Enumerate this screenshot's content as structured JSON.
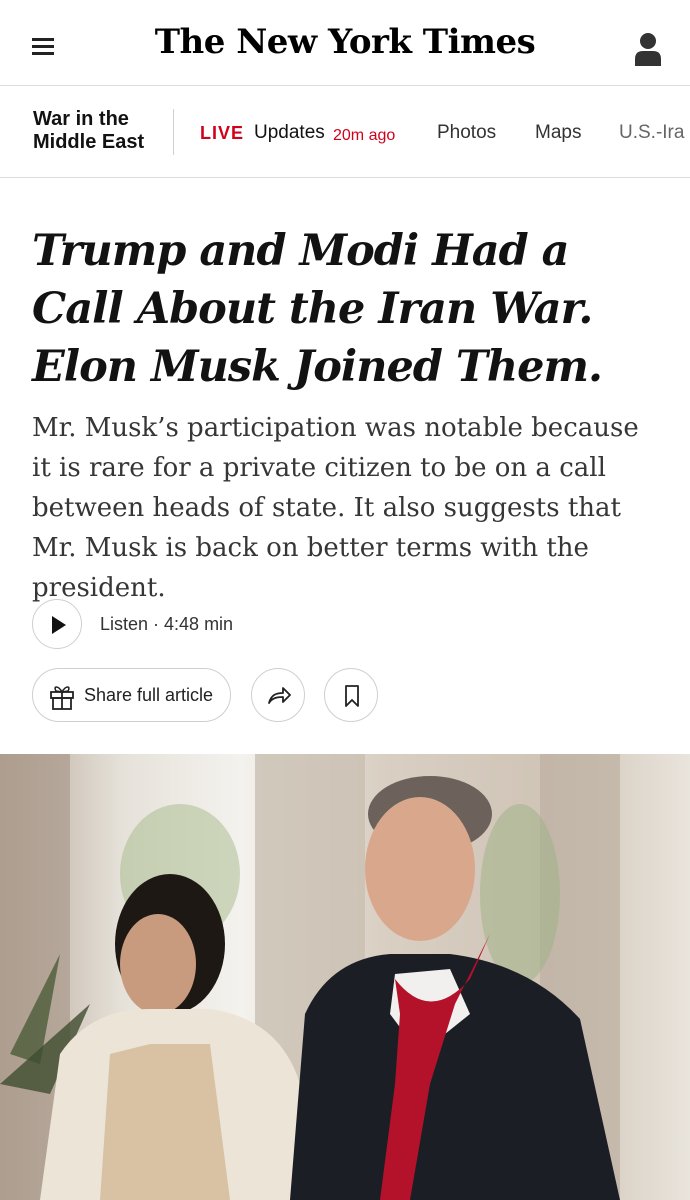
{
  "header": {
    "logo_text": "The New York Times",
    "menu_icon": "hamburger-menu-icon",
    "account_icon": "account-icon"
  },
  "section_nav": {
    "section_title_line1": "War in the",
    "section_title_line2": "Middle East",
    "live_label": "LIVE",
    "updates_label": "Updates",
    "updated_ago": "20m ago",
    "items": [
      {
        "label": "Photos"
      },
      {
        "label": "Maps"
      },
      {
        "label": "U.S.-Ira"
      }
    ]
  },
  "article": {
    "headline": "Trump and Modi Had a Call About the Iran War. Elon Musk Joined Them.",
    "summary": "Mr. Musk’s participation was notable because it is rare for a private citizen to be on a call between heads of state. It also suggests that Mr. Musk is back on better terms with the president.",
    "listen_label": "Listen · 4:48 min",
    "share_label": "Share full article"
  },
  "colors": {
    "live_red": "#d0021b",
    "text": "#121212",
    "tie_red": "#b3122a"
  }
}
